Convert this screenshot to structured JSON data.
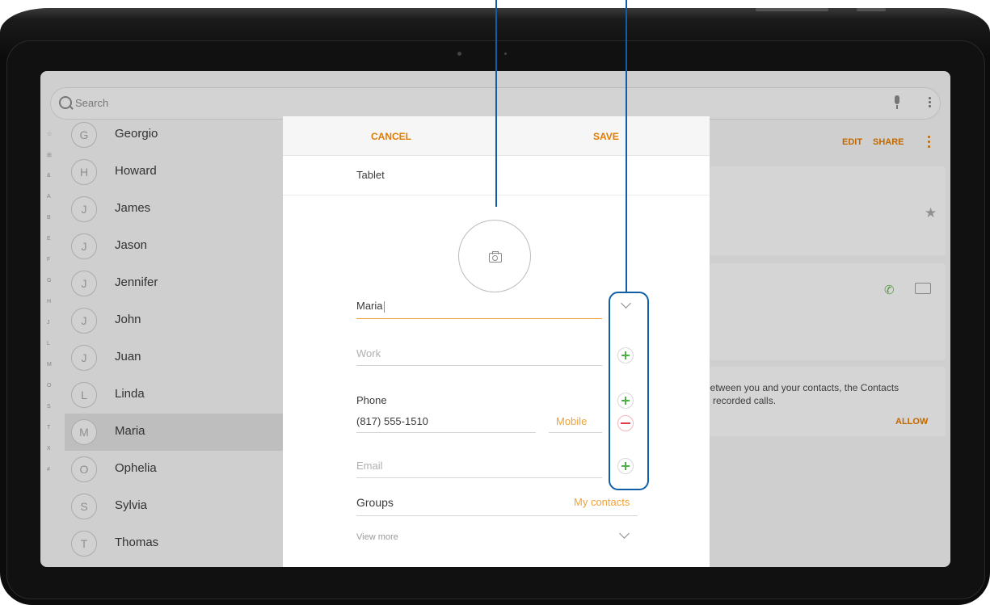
{
  "search": {
    "placeholder": "Search"
  },
  "alpha_index": [
    "☆",
    "⊞",
    "&",
    "A",
    "B",
    "E",
    "F",
    "G",
    "H",
    "J",
    "L",
    "M",
    "O",
    "S",
    "T",
    "X",
    "#"
  ],
  "contacts": [
    {
      "initial": "G",
      "name": "Georgio"
    },
    {
      "initial": "H",
      "name": "Howard"
    },
    {
      "initial": "J",
      "name": "James"
    },
    {
      "initial": "J",
      "name": "Jason"
    },
    {
      "initial": "J",
      "name": "Jennifer"
    },
    {
      "initial": "J",
      "name": "John"
    },
    {
      "initial": "J",
      "name": "Juan"
    },
    {
      "initial": "L",
      "name": "Linda"
    },
    {
      "initial": "M",
      "name": "Maria",
      "selected": true
    },
    {
      "initial": "O",
      "name": "Ophelia"
    },
    {
      "initial": "S",
      "name": "Sylvia"
    },
    {
      "initial": "T",
      "name": "Thomas"
    }
  ],
  "detail": {
    "edit_label": "EDIT",
    "share_label": "SHARE",
    "permission_text": "between you and your contacts, the Contacts\nd recorded calls.",
    "allow_label": "ALLOW"
  },
  "dialog": {
    "cancel_label": "CANCEL",
    "save_label": "SAVE",
    "account": "Tablet",
    "name_value": "Maria",
    "organization_placeholder": "Work",
    "phone_label": "Phone",
    "phone_value": "(817) 555-1510",
    "phone_type": "Mobile",
    "email_placeholder": "Email",
    "groups_label": "Groups",
    "groups_value": "My contacts",
    "view_more_label": "View more"
  },
  "colors": {
    "accent": "#e07b00",
    "add_green": "#4fb046",
    "remove_red": "#e03b4b",
    "callout_blue": "#0f5fa8"
  }
}
